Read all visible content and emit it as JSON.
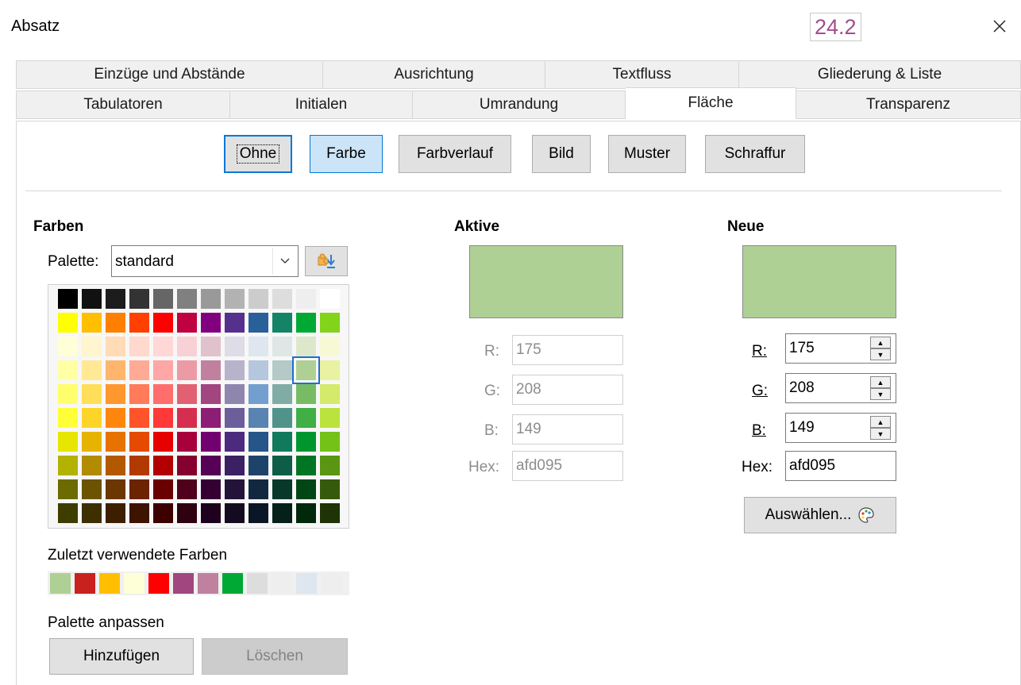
{
  "window": {
    "title": "Absatz",
    "version_badge": "24.2",
    "close_icon": "close-icon"
  },
  "tabs_row1": [
    {
      "label": "Einzüge und Abstände"
    },
    {
      "label": "Ausrichtung"
    },
    {
      "label": "Textfluss"
    },
    {
      "label": "Gliederung & Liste"
    }
  ],
  "tabs_row2": [
    {
      "label": "Tabulatoren"
    },
    {
      "label": "Initialen"
    },
    {
      "label": "Umrandung"
    },
    {
      "label": "Fläche",
      "active": true
    },
    {
      "label": "Transparenz"
    }
  ],
  "fill_buttons": [
    {
      "label": "Ohne",
      "state": "focused"
    },
    {
      "label": "Farbe",
      "state": "selected"
    },
    {
      "label": "Farbverlauf",
      "state": "normal"
    },
    {
      "label": "Bild",
      "state": "normal"
    },
    {
      "label": "Muster",
      "state": "normal"
    },
    {
      "label": "Schraffur",
      "state": "normal"
    }
  ],
  "colors": {
    "heading": "Farben",
    "palette_label": "Palette:",
    "palette_value": "standard",
    "palette_icon": "extension-import-icon",
    "dropdown_icon": "chevron-down-icon",
    "grid": [
      [
        "#000000",
        "#111111",
        "#1c1c1c",
        "#333333",
        "#666666",
        "#808080",
        "#999999",
        "#b2b2b2",
        "#cccccc",
        "#dddddd",
        "#eeeeee",
        "#ffffff"
      ],
      [
        "#ffff00",
        "#ffbf00",
        "#ff8000",
        "#ff4000",
        "#ff0000",
        "#bf0041",
        "#800080",
        "#55308d",
        "#2a6099",
        "#158466",
        "#00a933",
        "#81d41a"
      ],
      [
        "#ffffd7",
        "#fff5ce",
        "#ffdbb6",
        "#ffd8ce",
        "#ffd7d7",
        "#f7d1d5",
        "#e0c2cd",
        "#dedce6",
        "#dee6ef",
        "#dee7e5",
        "#dde8cb",
        "#f6f9d4"
      ],
      [
        "#ffffa6",
        "#ffe994",
        "#ffb66c",
        "#ffaa95",
        "#ffa6a6",
        "#ec9ba4",
        "#bf819e",
        "#b7b3ca",
        "#b4c7dc",
        "#b3cac7",
        "#afd095",
        "#e8f2a1"
      ],
      [
        "#ffff6d",
        "#ffde59",
        "#ff972f",
        "#ff7b59",
        "#ff6d6d",
        "#e16173",
        "#a1467e",
        "#8e86ae",
        "#729fcf",
        "#81aca6",
        "#77bc65",
        "#d4ea6b"
      ],
      [
        "#ffff38",
        "#ffd428",
        "#ff860d",
        "#ff5429",
        "#ff3838",
        "#d62e4e",
        "#8d1d75",
        "#6b5e9b",
        "#5983b0",
        "#50938a",
        "#3faf46",
        "#bbe33d"
      ],
      [
        "#e6e600",
        "#e6b400",
        "#e67300",
        "#e64a00",
        "#e60000",
        "#a8003b",
        "#710071",
        "#4c2b7f",
        "#265589",
        "#127a5c",
        "#00962e",
        "#74c118"
      ],
      [
        "#b2b200",
        "#b28b00",
        "#b25900",
        "#b23a00",
        "#b20000",
        "#85002e",
        "#560056",
        "#3b2063",
        "#1e436a",
        "#0e5e47",
        "#007524",
        "#5a9612"
      ],
      [
        "#6b6b00",
        "#6b5300",
        "#6b3600",
        "#6b2300",
        "#6b0000",
        "#50001c",
        "#340034",
        "#241339",
        "#122840",
        "#08382a",
        "#004616",
        "#365a0b"
      ],
      [
        "#3d3d00",
        "#3d2f00",
        "#3d1f00",
        "#3d1400",
        "#3d0000",
        "#2e0010",
        "#1e001e",
        "#150b21",
        "#0a1625",
        "#052018",
        "#00280c",
        "#1e3306"
      ]
    ],
    "selected_row": 3,
    "selected_col": 10,
    "recent_label": "Zuletzt verwendete Farben",
    "recent": [
      "#afd095",
      "#c9211e",
      "#ffbf00",
      "#ffffd7",
      "#ff0000",
      "#a1467e",
      "#bf819e",
      "#00a933",
      "#dddddd",
      "#eeeeee",
      "#dee6ef",
      "#eeeeee"
    ],
    "customize_label": "Palette anpassen",
    "add_label": "Hinzufügen",
    "delete_label": "Löschen"
  },
  "active": {
    "heading": "Aktive",
    "color": "#afd095",
    "r_label": "R:",
    "r": "175",
    "g_label": "G:",
    "g": "208",
    "b_label": "B:",
    "b": "149",
    "hex_label": "Hex:",
    "hex": "afd095"
  },
  "neue": {
    "heading": "Neue",
    "color": "#afd095",
    "r_label": "R:",
    "r": "175",
    "g_label": "G:",
    "g": "208",
    "b_label": "B:",
    "b": "149",
    "hex_label": "Hex:",
    "hex": "afd095",
    "pick_label": "Auswählen...",
    "pick_icon": "color-palette-icon"
  }
}
